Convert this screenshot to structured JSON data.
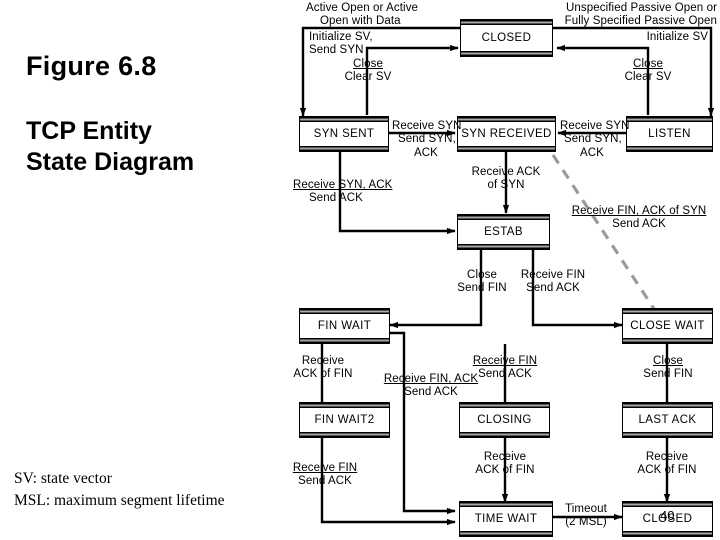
{
  "title": {
    "figure": "Figure 6.8",
    "subtitle_line1": "TCP Entity",
    "subtitle_line2": "State Diagram"
  },
  "legend": {
    "sv": "SV: state vector",
    "msl": "MSL: maximum segment lifetime"
  },
  "artifact": {
    "page_number": "40"
  },
  "states": [
    {
      "id": "closed_top",
      "label": "CLOSED"
    },
    {
      "id": "syn_sent",
      "label": "SYN SENT"
    },
    {
      "id": "syn_received",
      "label": "SYN RECEIVED"
    },
    {
      "id": "listen",
      "label": "LISTEN"
    },
    {
      "id": "estab",
      "label": "ESTAB"
    },
    {
      "id": "fin_wait",
      "label": "FIN WAIT"
    },
    {
      "id": "close_wait",
      "label": "CLOSE WAIT"
    },
    {
      "id": "fin_wait2",
      "label": "FIN WAIT2"
    },
    {
      "id": "closing",
      "label": "CLOSING"
    },
    {
      "id": "last_ack",
      "label": "LAST ACK"
    },
    {
      "id": "time_wait",
      "label": "TIME WAIT"
    },
    {
      "id": "closed_bottom",
      "label": "CLOSED"
    }
  ],
  "transitions": [
    {
      "id": "active_open",
      "from": "closed_top",
      "to": "syn_sent",
      "event": "Active Open or Active Open with Data",
      "line1": "Active Open or Active",
      "line2": "Open with Data",
      "line3": "Initialize SV,",
      "line4": "Send SYN"
    },
    {
      "id": "passive_open",
      "from": "closed_top",
      "to": "listen",
      "event": "Unspecified Passive Open or Fully Specified Passive Open",
      "line1": "Unspecified Passive Open or",
      "line2": "Fully Specified Passive Open",
      "line3": "Initialize SV"
    },
    {
      "id": "syn_sent_close",
      "from": "syn_sent",
      "to": "closed_top",
      "line1": "Close",
      "line2": "Clear SV"
    },
    {
      "id": "listen_close",
      "from": "listen",
      "to": "closed_top",
      "line1": "Close",
      "line2": "Clear SV"
    },
    {
      "id": "syn_sent_to_rcvd",
      "from": "syn_sent",
      "to": "syn_received",
      "line1": "Receive SYN",
      "line2": "Send SYN,",
      "line3": "ACK"
    },
    {
      "id": "listen_to_rcvd",
      "from": "listen",
      "to": "syn_received",
      "line1": "Receive SYN",
      "line2": "Send SYN,",
      "line3": "ACK"
    },
    {
      "id": "rcvd_to_estab",
      "from": "syn_received",
      "to": "estab",
      "line1": "Receive ACK",
      "line2": "of SYN"
    },
    {
      "id": "sent_to_estab",
      "from": "syn_sent",
      "to": "estab",
      "line1": "Receive SYN, ACK",
      "line2": "Send ACK"
    },
    {
      "id": "rcvd_to_closewait",
      "from": "syn_received",
      "to": "close_wait",
      "style": "dashed",
      "line1": "Receive FIN, ACK of SYN",
      "line2": "Send ACK"
    },
    {
      "id": "estab_close",
      "from": "estab",
      "to": "fin_wait",
      "line1": "Close",
      "line2": "Send FIN"
    },
    {
      "id": "estab_fin",
      "from": "estab",
      "to": "close_wait",
      "line1": "Receive FIN",
      "line2": "Send ACK"
    },
    {
      "id": "finwait_ack",
      "from": "fin_wait",
      "to": "fin_wait2",
      "line1": "Receive",
      "line2": "ACK of FIN"
    },
    {
      "id": "finwait_finack",
      "from": "fin_wait",
      "to": "time_wait",
      "line1": "Receive FIN, ACK",
      "line2": "Send ACK"
    },
    {
      "id": "finwait_fin",
      "from": "fin_wait",
      "to": "closing",
      "line1": "Receive FIN",
      "line2": "Send ACK"
    },
    {
      "id": "closewait_close",
      "from": "close_wait",
      "to": "last_ack",
      "line1": "Close",
      "line2": "Send FIN"
    },
    {
      "id": "finwait2_fin",
      "from": "fin_wait2",
      "to": "time_wait",
      "line1": "Receive FIN",
      "line2": "Send ACK"
    },
    {
      "id": "closing_ack",
      "from": "closing",
      "to": "time_wait",
      "line1": "Receive",
      "line2": "ACK of FIN"
    },
    {
      "id": "lastack_ack",
      "from": "last_ack",
      "to": "closed_bottom",
      "line1": "Receive",
      "line2": "ACK of FIN"
    },
    {
      "id": "timewait_timeout",
      "from": "time_wait",
      "to": "closed_bottom",
      "line1": "Timeout",
      "line2": "(2 MSL)"
    }
  ]
}
